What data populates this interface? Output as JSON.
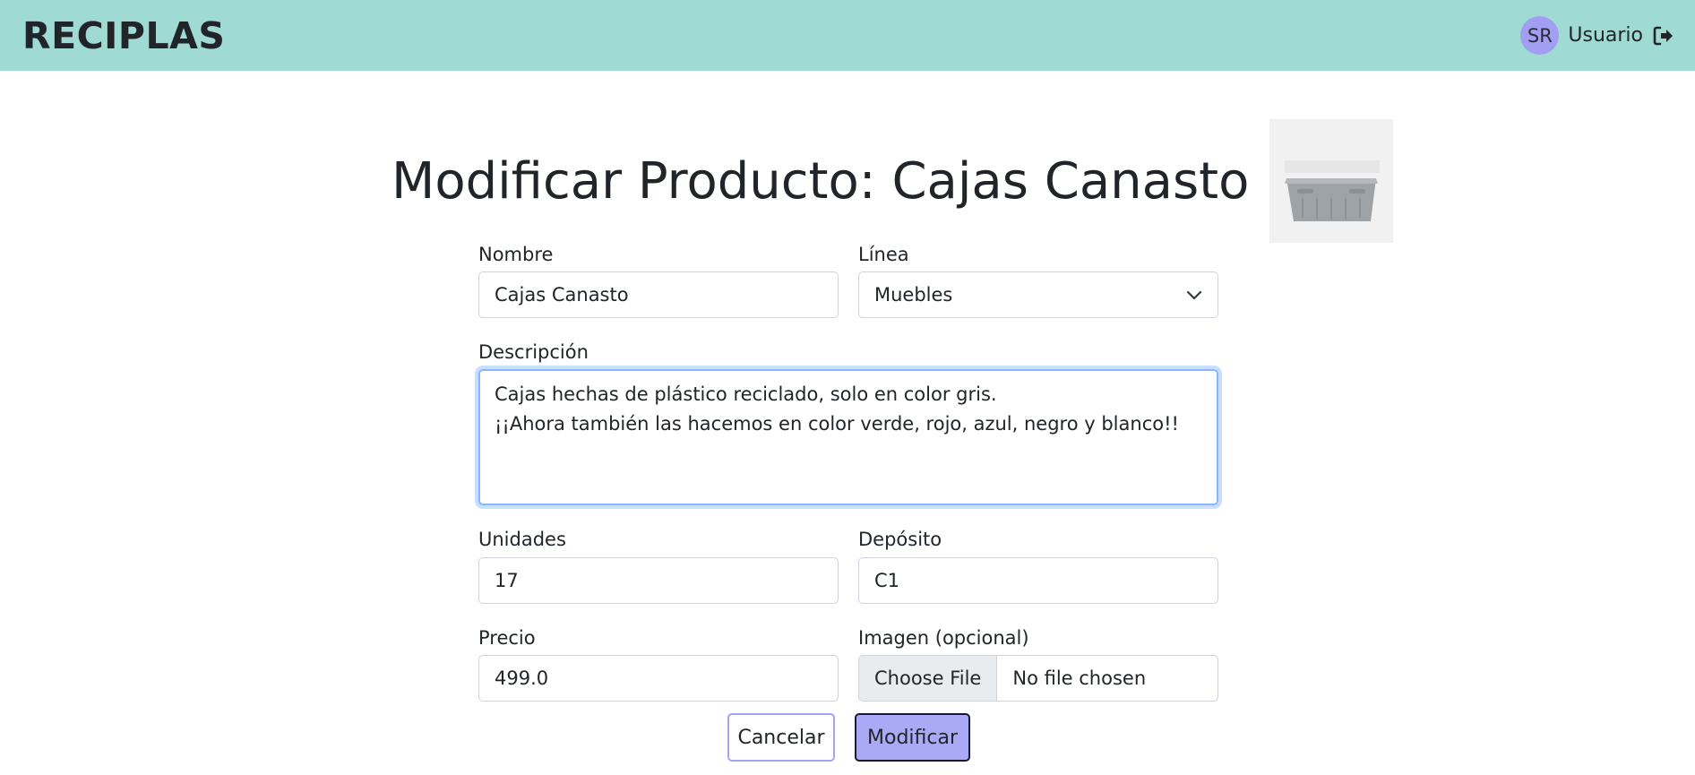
{
  "navbar": {
    "brand": "RECIPLAS",
    "avatar_initials": "SR",
    "username": "Usuario",
    "logout_icon": "sign-out-icon",
    "background": "#9fdad3"
  },
  "page": {
    "title": "Modificar Producto: Cajas Canasto",
    "product_image": "gray-plastic-crate-image"
  },
  "form": {
    "nombre": {
      "label": "Nombre",
      "value": "Cajas Canasto"
    },
    "linea": {
      "label": "Línea",
      "value": "Muebles"
    },
    "descripcion": {
      "label": "Descripción",
      "value": "Cajas hechas de plástico reciclado, solo en color gris.\n¡¡Ahora también las hacemos en color verde, rojo, azul, negro y blanco!!"
    },
    "unidades": {
      "label": "Unidades",
      "value": "17"
    },
    "deposito": {
      "label": "Depósito",
      "value": "C1"
    },
    "precio": {
      "label": "Precio",
      "value": "499.0"
    },
    "imagen": {
      "label": "Imagen (opcional)",
      "button": "Choose File",
      "status": "No file chosen"
    }
  },
  "actions": {
    "cancel_label": "Cancelar",
    "submit_label": "Modificar",
    "submit_color": "#aaa9f5"
  }
}
